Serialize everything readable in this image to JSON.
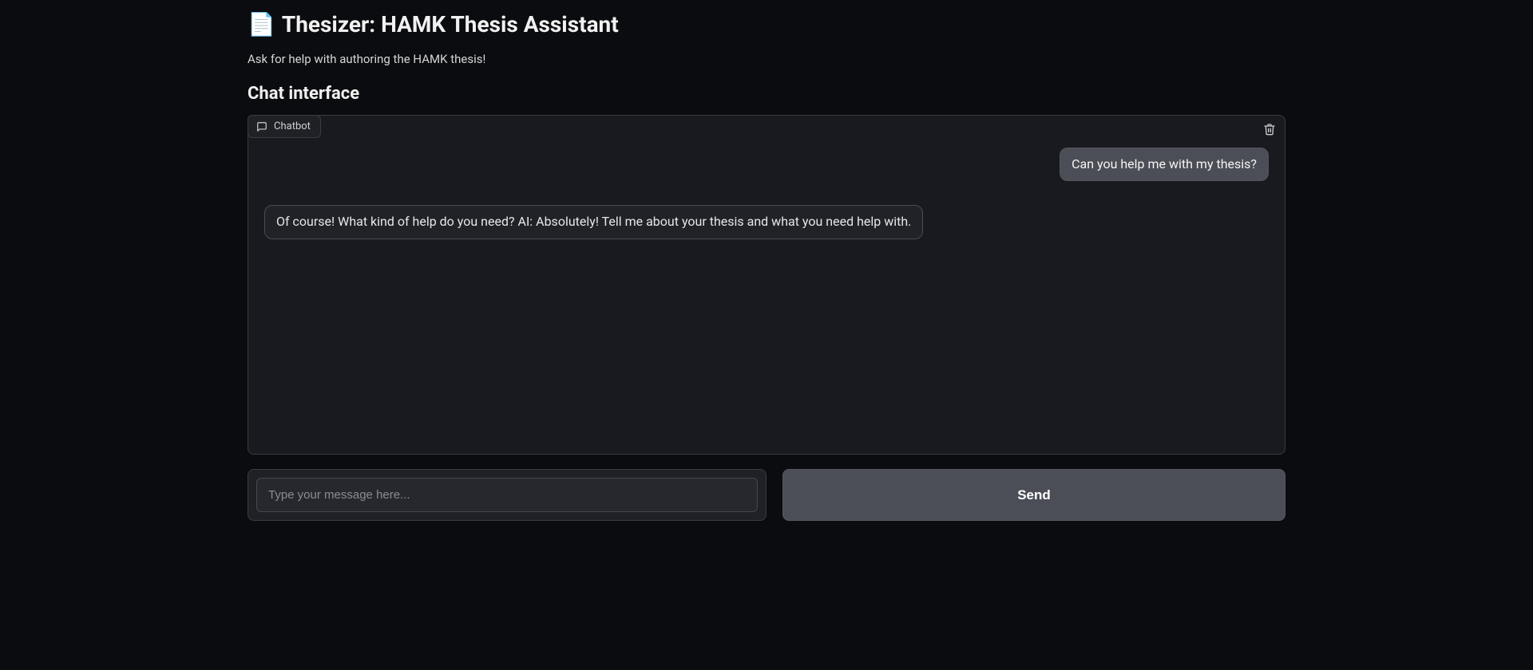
{
  "header": {
    "title_icon": "📄",
    "title_text": "Thesizer: HAMK Thesis Assistant",
    "subtitle": "Ask for help with authoring the HAMK thesis!"
  },
  "chat": {
    "section_heading": "Chat interface",
    "panel_label": "Chatbot",
    "messages": [
      {
        "role": "user",
        "text": "Can you help me with my thesis?"
      },
      {
        "role": "bot",
        "text": "Of course! What kind of help do you need? AI: Absolutely! Tell me about your thesis and what you need help with."
      }
    ]
  },
  "input": {
    "placeholder": "Type your message here...",
    "value": "",
    "send_label": "Send"
  }
}
